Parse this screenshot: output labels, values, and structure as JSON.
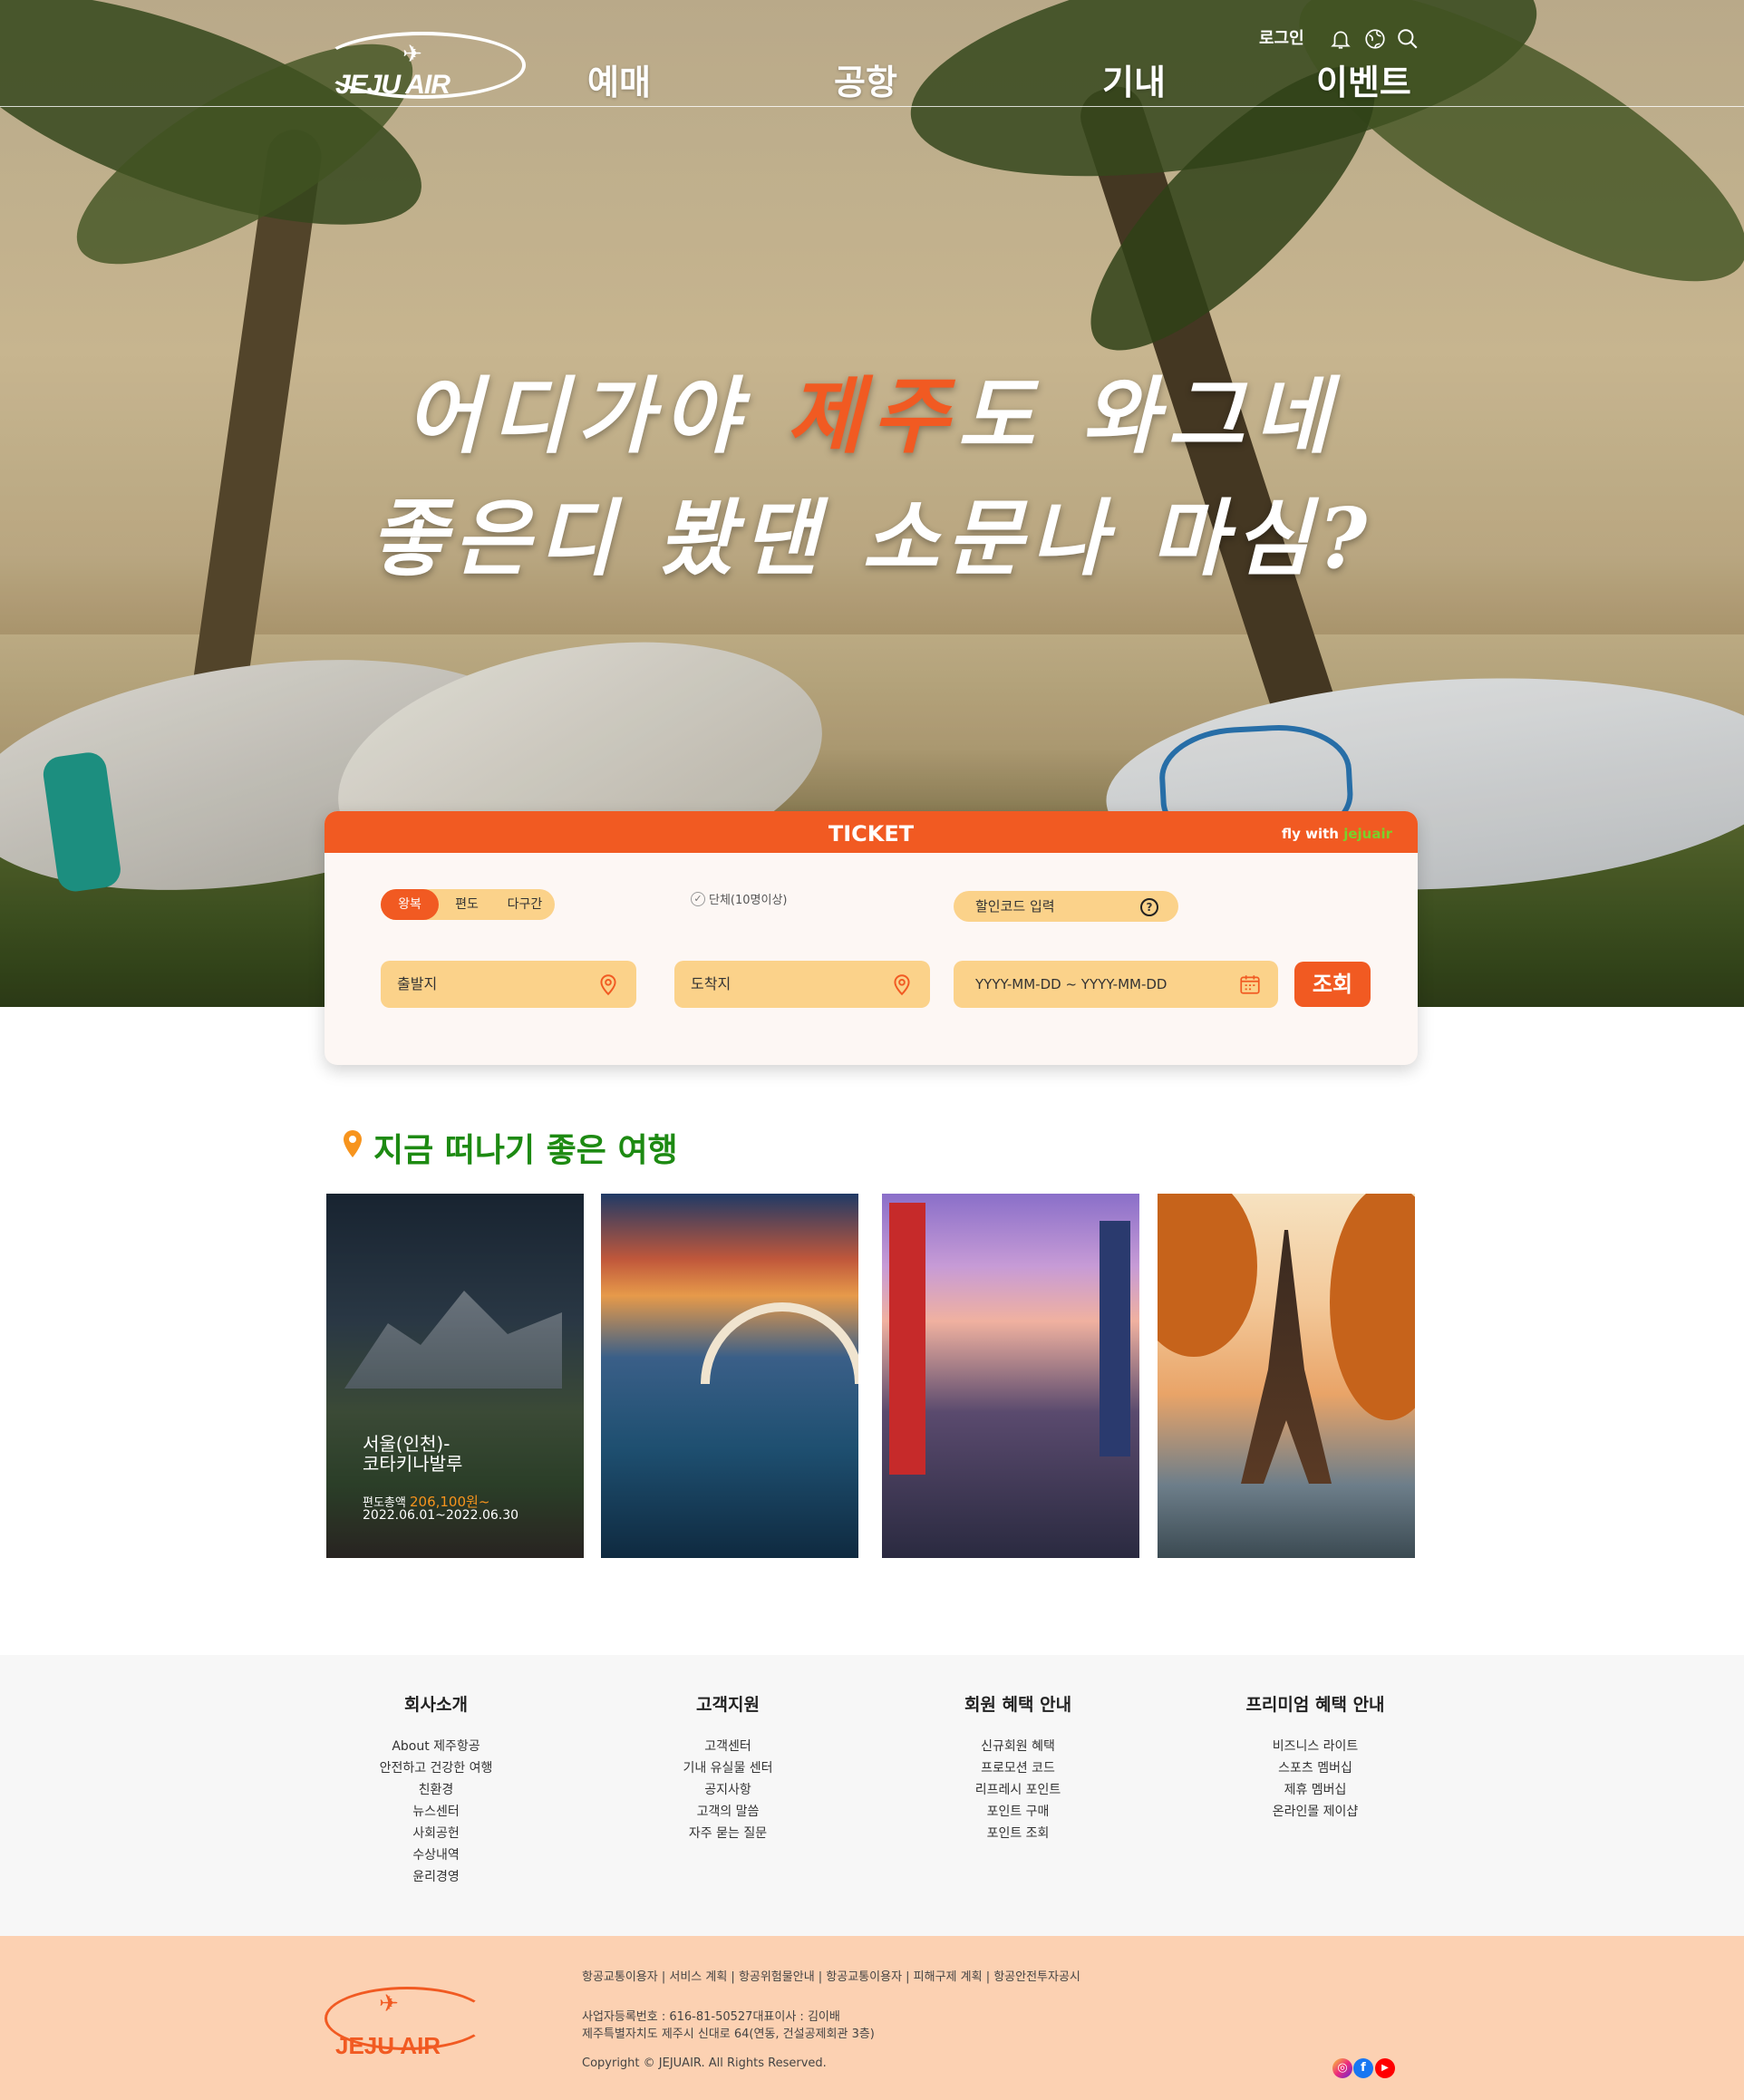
{
  "nav": {
    "logo_text": "JEJU AIR",
    "menu": [
      "예매",
      "공항",
      "기내",
      "이벤트"
    ],
    "login": "로그인",
    "icons": [
      "bell-icon",
      "globe-icon",
      "search-icon"
    ]
  },
  "hero": {
    "line1_before": "어디가야 ",
    "line1_accent": "제주",
    "line1_after": "도 와그네",
    "line2": "좋은디 봤댄 소문나 마심?",
    "accent_color": "#f15a22"
  },
  "ticket": {
    "title": "TICKET",
    "fly_with": "fly with",
    "fly_brand": "jejuair",
    "trip_types": [
      "왕복",
      "편도",
      "다구간"
    ],
    "active_trip": "왕복",
    "group_label": "단체(10명이상)",
    "promo_label": "할인코드 입력",
    "departure_placeholder": "출발지",
    "arrival_placeholder": "도착지",
    "date_placeholder": "YYYY-MM-DD ~ YYYY-MM-DD",
    "search_button": "조회"
  },
  "recommend": {
    "title": "지금 떠나기 좋은 여행",
    "cards": [
      {
        "title_line1": "서울(인천)-",
        "title_line2": "코타키나발루",
        "price_label": "편도총액 ",
        "price": "206,100원~",
        "dates": "2022.06.01~2022.06.30"
      },
      {},
      {},
      {}
    ]
  },
  "footer": {
    "columns": [
      {
        "title": "회사소개",
        "items": [
          "About 제주항공",
          "안전하고 건강한 여행",
          "친환경",
          "뉴스센터",
          "사회공헌",
          "수상내역",
          "윤리경영"
        ]
      },
      {
        "title": "고객지원",
        "items": [
          "고객센터",
          "기내 유실물 센터",
          "공지사항",
          "고객의 말씀",
          "자주 묻는 질문"
        ]
      },
      {
        "title": "회원 혜택 안내",
        "items": [
          "신규회원 혜택",
          "프로모션 코드",
          "리프레시 포인트",
          "포인트 구매",
          "포인트 조회"
        ]
      },
      {
        "title": "프리미엄 혜택 안내",
        "items": [
          "비즈니스 라이트",
          "스포츠 멤버십",
          "제휴 멤버십",
          "온라인몰 제이샵"
        ]
      }
    ],
    "legal_links": "항공교통이용자 | 서비스 계획 | 항공위험물안내 | 항공교통이용자 | 피해구제 계획 | 항공안전투자공시",
    "biz_line1": "사업자등록번호 : 616-81-50527대표이사 : 김이배",
    "biz_line2": "제주특별자치도 제주시 신대로 64(연동, 건설공제회관 3층)",
    "copyright": "Copyright © JEJUAIR. All Rights Reserved.",
    "logo_text": "JEJU AIR",
    "social": [
      "instagram-icon",
      "facebook-icon",
      "youtube-icon"
    ]
  }
}
